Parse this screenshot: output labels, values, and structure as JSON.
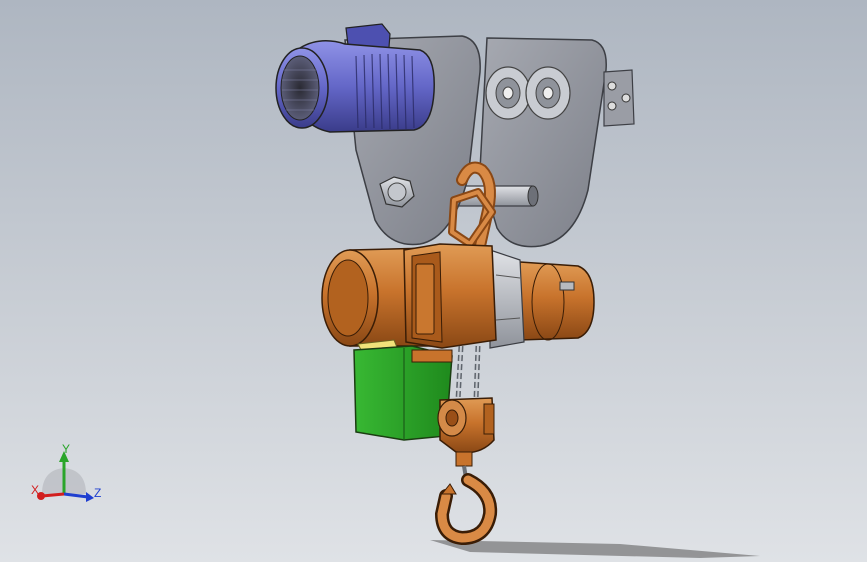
{
  "axes": {
    "x": "X",
    "y": "Y",
    "z": "Z"
  },
  "colors": {
    "background_top": "#aeb6c1",
    "background_bottom": "#dfe2e6",
    "motor": "#6c6fd0",
    "trolley": "#8c8f98",
    "hoist": "#c8732c",
    "control_box": "#2fa82c",
    "axis_x": "#d21e1e",
    "axis_y": "#2aa52a",
    "axis_z": "#1f3fd0"
  },
  "icons": {
    "triad": "view-orientation-triad-icon"
  }
}
